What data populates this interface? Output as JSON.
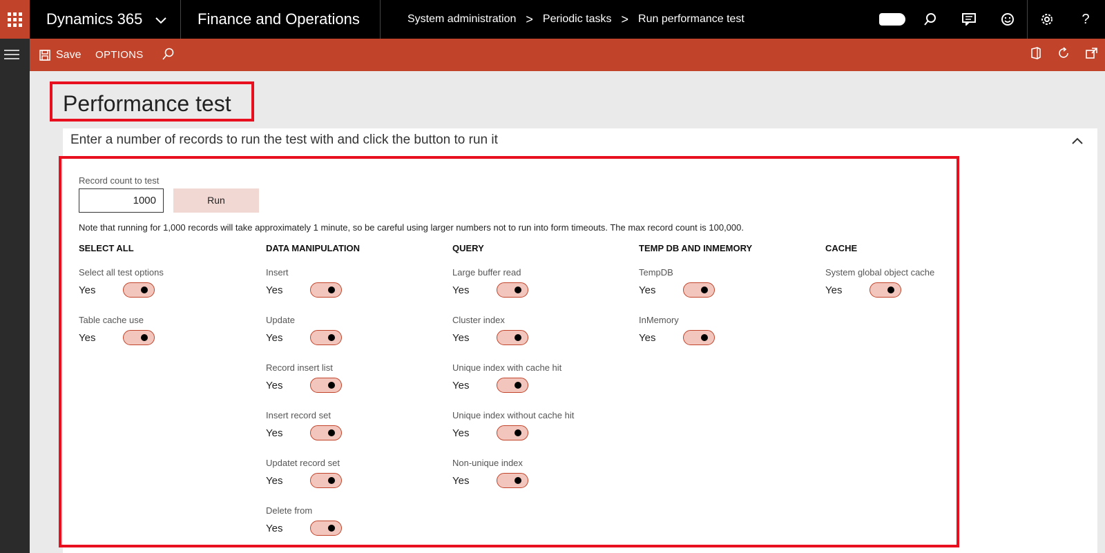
{
  "topbar": {
    "brand": "Dynamics 365",
    "app": "Finance and Operations",
    "breadcrumbs": [
      "System administration",
      "Periodic tasks",
      "Run performance test"
    ]
  },
  "actionbar": {
    "save_label": "Save",
    "options_label": "OPTIONS"
  },
  "page": {
    "title": "Performance test",
    "section_header": "Enter a number of records to run the test with and click the button to run it"
  },
  "form": {
    "record_count_label": "Record count to test",
    "record_count_value": "1000",
    "run_label": "Run",
    "note": "Note that running for 1,000 records will take approximately 1 minute, so be careful using larger numbers not to run into form timeouts. The max record count is 100,000.",
    "columns": [
      {
        "header": "SELECT ALL",
        "options": [
          {
            "label": "Select all test options",
            "value": "Yes"
          },
          {
            "label": "Table cache use",
            "value": "Yes"
          }
        ]
      },
      {
        "header": "DATA MANIPULATION",
        "options": [
          {
            "label": "Insert",
            "value": "Yes"
          },
          {
            "label": "Update",
            "value": "Yes"
          },
          {
            "label": "Record insert list",
            "value": "Yes"
          },
          {
            "label": "Insert record set",
            "value": "Yes"
          },
          {
            "label": "Updatet record set",
            "value": "Yes"
          },
          {
            "label": "Delete from",
            "value": "Yes"
          }
        ]
      },
      {
        "header": "QUERY",
        "options": [
          {
            "label": "Large buffer read",
            "value": "Yes"
          },
          {
            "label": "Cluster index",
            "value": "Yes"
          },
          {
            "label": "Unique index with cache hit",
            "value": "Yes"
          },
          {
            "label": "Unique index without cache hit",
            "value": "Yes"
          },
          {
            "label": "Non-unique index",
            "value": "Yes"
          }
        ]
      },
      {
        "header": "TEMP DB AND INMEMORY",
        "options": [
          {
            "label": "TempDB",
            "value": "Yes"
          },
          {
            "label": "InMemory",
            "value": "Yes"
          }
        ]
      },
      {
        "header": "CACHE",
        "options": [
          {
            "label": "System global object cache",
            "value": "Yes"
          }
        ]
      }
    ]
  },
  "colors": {
    "accent": "#c1432a",
    "highlight": "#e8101e",
    "toggle_fill": "#f2c6bc"
  }
}
